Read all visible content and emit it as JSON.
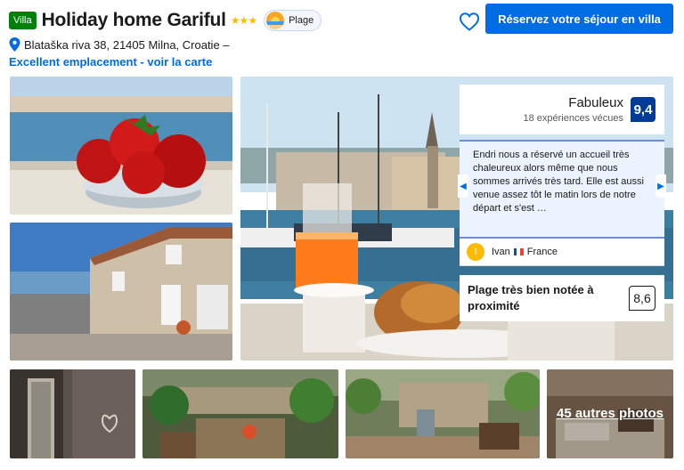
{
  "header": {
    "type_badge": "Villa",
    "name": "Holiday home Gariful",
    "stars": "★★★",
    "beach_badge": "Plage",
    "address": "Blataška riva 38, 21405 Milna, Croatie –",
    "location_link": "Excellent emplacement - voir la carte",
    "reserve_button": "Réservez votre séjour en villa"
  },
  "review": {
    "score_word": "Fabuleux",
    "review_count": "18 expériences vécues",
    "score": "9,4",
    "quote": "Endri nous a réservé un accueil très chaleureux alors même que nous sommes arrivés très tard. Elle est aussi venue assez tôt le matin lors de notre départ et s'est …",
    "reviewer_initial": "I",
    "reviewer_name": "Ivan",
    "reviewer_country": "France",
    "beach_label": "Plage très bien notée à proximité",
    "beach_score": "8,6"
  },
  "gallery": {
    "more_photos": "45 autres photos"
  },
  "colors": {
    "brand_blue": "#006ce4",
    "score_blue": "#003b95",
    "star_yellow": "#febb02",
    "villa_green": "#008009"
  },
  "icons": {
    "location": "map-pin-icon",
    "favorite": "heart-icon",
    "beach": "beach-icon"
  }
}
